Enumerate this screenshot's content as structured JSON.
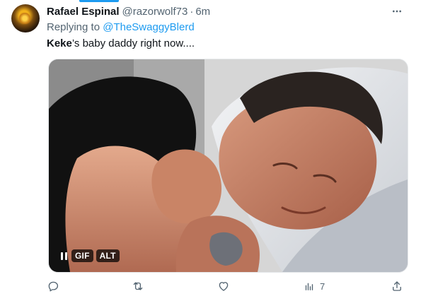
{
  "tweet": {
    "display_name": "Rafael Espinal",
    "handle": "@razorwolf73",
    "separator": "·",
    "time": "6m",
    "replying_prefix": "Replying to",
    "replying_to": "@TheSwaggyBlerd",
    "text_bold": "Keke",
    "text_rest": "’s baby daddy right now....",
    "media": {
      "gif_label": "GIF",
      "alt_label": "ALT"
    },
    "metrics": {
      "views": "7"
    },
    "icons": {
      "more": "more-icon",
      "reply": "reply-icon",
      "retweet": "retweet-icon",
      "like": "like-icon",
      "views": "views-icon",
      "share": "share-icon",
      "pause": "pause-icon"
    },
    "colors": {
      "accent": "#1d9bf0",
      "text": "#0f1419",
      "secondary": "#536471"
    }
  }
}
